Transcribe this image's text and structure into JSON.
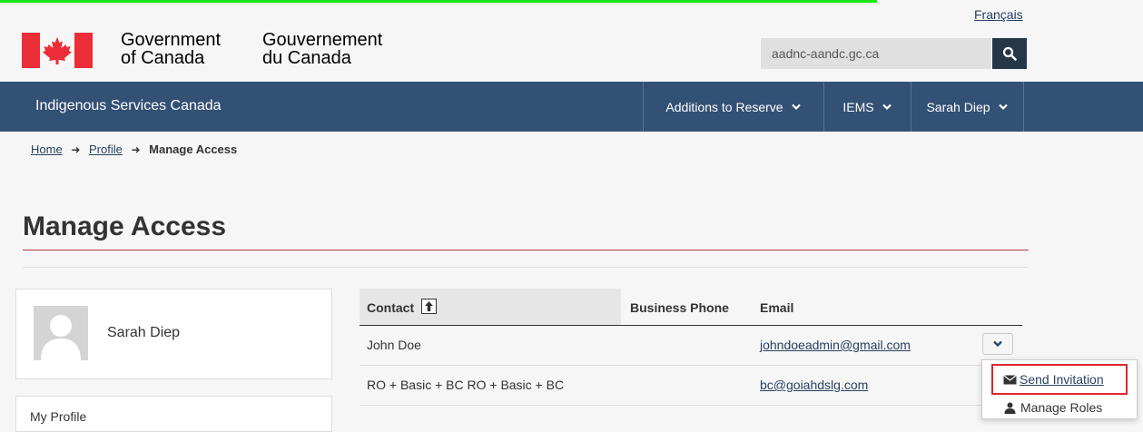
{
  "header": {
    "language_link": "Français",
    "gov_en_line1": "Government",
    "gov_en_line2": "of Canada",
    "gov_fr_line1": "Gouvernement",
    "gov_fr_line2": "du Canada",
    "search_value": "aadnc-aandc.gc.ca"
  },
  "nav": {
    "brand": "Indigenous Services Canada",
    "menu": [
      {
        "label": "Additions to Reserve"
      },
      {
        "label": "IEMS"
      },
      {
        "label": "Sarah Diep"
      }
    ]
  },
  "breadcrumb": {
    "home": "Home",
    "profile": "Profile",
    "current": "Manage Access"
  },
  "page": {
    "title": "Manage Access"
  },
  "sidebar": {
    "user_name": "Sarah Diep",
    "nav_item": "My Profile"
  },
  "table": {
    "headers": {
      "contact": "Contact",
      "phone": "Business Phone",
      "email": "Email"
    },
    "rows": [
      {
        "contact": "John Doe",
        "phone": "",
        "email": "johndoeadmin@gmail.com"
      },
      {
        "contact": "RO + Basic + BC RO + Basic + BC",
        "phone": "",
        "email": "bc@goiahdslg.com"
      }
    ]
  },
  "row_menu": {
    "send_invitation": "Send Invitation",
    "manage_roles": "Manage Roles"
  },
  "colors": {
    "nav_bg": "#335075",
    "link": "#284162",
    "title_rule": "#af3c43",
    "highlight": "#e0252d"
  },
  "icons": [
    "canada-flag-icon",
    "search-icon",
    "chevron-down-icon",
    "sort-up-icon",
    "avatar-icon",
    "envelope-icon",
    "user-icon"
  ]
}
